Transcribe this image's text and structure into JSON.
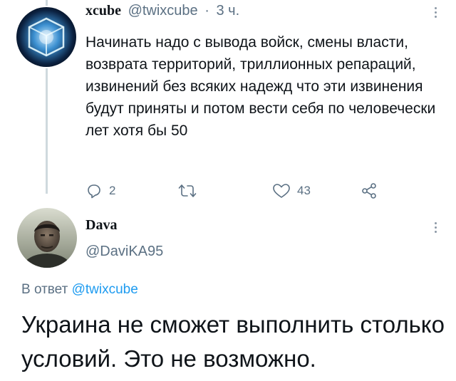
{
  "tweet1": {
    "author_name": "xcube",
    "handle": "@twixcube",
    "separator": "·",
    "time": "3 ч.",
    "text": "Начинать надо с вывода войск, смены власти, возврата территорий, триллионных репараций, извинений без всяких надежд что эти извинения будут приняты и потом вести себя по человечески лет хотя бы 50",
    "actions": {
      "reply_count": "2",
      "retweet_count": "",
      "like_count": "43"
    },
    "icons": {
      "reply": "reply-icon",
      "retweet": "retweet-icon",
      "like": "heart-icon",
      "share": "share-icon"
    }
  },
  "tweet2": {
    "author_name": "Dava",
    "handle": "@DaviKA95",
    "reply_prefix": "В ответ",
    "reply_to": "@twixcube",
    "text": "Украина не сможет выполнить столько условий. Это не возможно."
  },
  "colors": {
    "link": "#1d9bf0",
    "muted": "#5b7083",
    "text": "#0f1419",
    "thread_line": "#cfd9de"
  }
}
